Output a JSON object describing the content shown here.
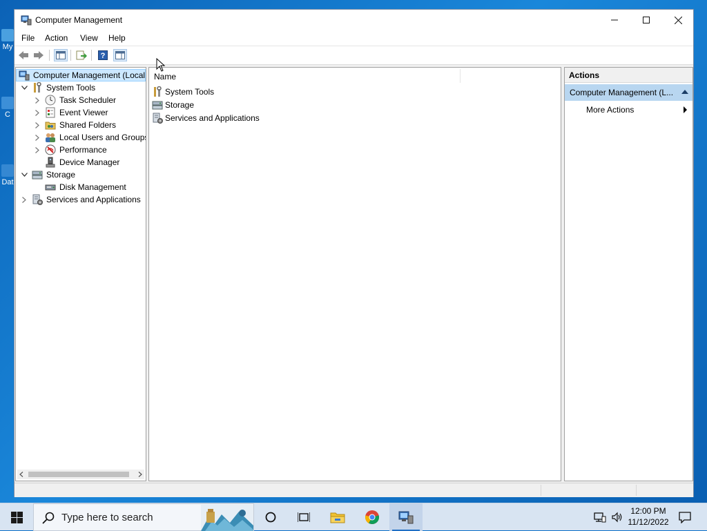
{
  "desktop": {
    "icons": [
      {
        "label": "My",
        "icon": "computer-icon"
      },
      {
        "label": "C",
        "icon": "folder-icon"
      },
      {
        "label": "Dat",
        "icon": "file-icon"
      }
    ]
  },
  "window": {
    "title": "Computer Management",
    "controls": {
      "minimize": "minimize-icon",
      "maximize": "maximize-icon",
      "close": "close-icon"
    },
    "menu": [
      "File",
      "Action",
      "View",
      "Help"
    ],
    "toolbar": [
      "back-arrow-icon",
      "forward-arrow-icon",
      "show-hide-console-tree-icon",
      "export-list-icon",
      "help-icon",
      "show-hide-action-pane-icon"
    ]
  },
  "tree": {
    "items": [
      {
        "label": "Computer Management (Local",
        "level": 0,
        "expander": "",
        "icon": "computer-management-icon",
        "selected": true
      },
      {
        "label": "System Tools",
        "level": 1,
        "expander": "expanded",
        "icon": "tools-icon"
      },
      {
        "label": "Task Scheduler",
        "level": 2,
        "expander": "collapsed",
        "icon": "clock-icon"
      },
      {
        "label": "Event Viewer",
        "level": 2,
        "expander": "collapsed",
        "icon": "event-viewer-icon"
      },
      {
        "label": "Shared Folders",
        "level": 2,
        "expander": "collapsed",
        "icon": "shared-folder-icon"
      },
      {
        "label": "Local Users and Groups",
        "level": 2,
        "expander": "collapsed",
        "icon": "users-icon"
      },
      {
        "label": "Performance",
        "level": 2,
        "expander": "collapsed",
        "icon": "performance-icon"
      },
      {
        "label": "Device Manager",
        "level": 2,
        "expander": "",
        "icon": "device-manager-icon"
      },
      {
        "label": "Storage",
        "level": 1,
        "expander": "expanded",
        "icon": "storage-icon"
      },
      {
        "label": "Disk Management",
        "level": 2,
        "expander": "",
        "icon": "disk-icon"
      },
      {
        "label": "Services and Applications",
        "level": 1,
        "expander": "collapsed",
        "icon": "services-icon"
      }
    ]
  },
  "list": {
    "column": "Name",
    "rows": [
      {
        "label": "System Tools",
        "icon": "tools-icon"
      },
      {
        "label": "Storage",
        "icon": "storage-icon"
      },
      {
        "label": "Services and Applications",
        "icon": "services-icon"
      }
    ]
  },
  "actions": {
    "title": "Actions",
    "section": "Computer Management (L...",
    "items": [
      {
        "label": "More Actions"
      }
    ]
  },
  "taskbar": {
    "search_placeholder": "Type here to search",
    "time": "12:00 PM",
    "date": "11/12/2022"
  },
  "colors": {
    "selection": "#cce8ff",
    "actions_header": "#b8d6f0",
    "taskbar": "#d8e4f2",
    "desktop": "#1a87da"
  }
}
